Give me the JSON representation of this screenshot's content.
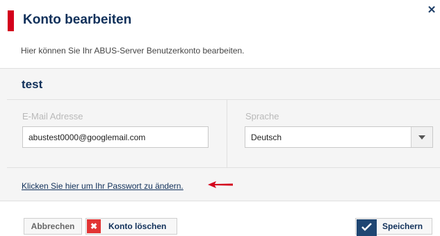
{
  "dialog": {
    "title": "Konto bearbeiten",
    "close_icon": "close-icon",
    "intro": "Hier können Sie Ihr ABUS-Server Benutzerkonto bearbeiten.",
    "accent_color": "#d3001c"
  },
  "account": {
    "name": "test",
    "email_label": "E-Mail Adresse",
    "email_value": "abustest0000@googlemail.com",
    "language_label": "Sprache",
    "language_value": "Deutsch",
    "password_link": "Klicken Sie hier um Ihr Passwort zu ändern."
  },
  "buttons": {
    "cancel": "Abbrechen",
    "delete": "Konto löschen",
    "delete_color": "#e23434",
    "save": "Speichern",
    "save_color": "#1f4672"
  }
}
